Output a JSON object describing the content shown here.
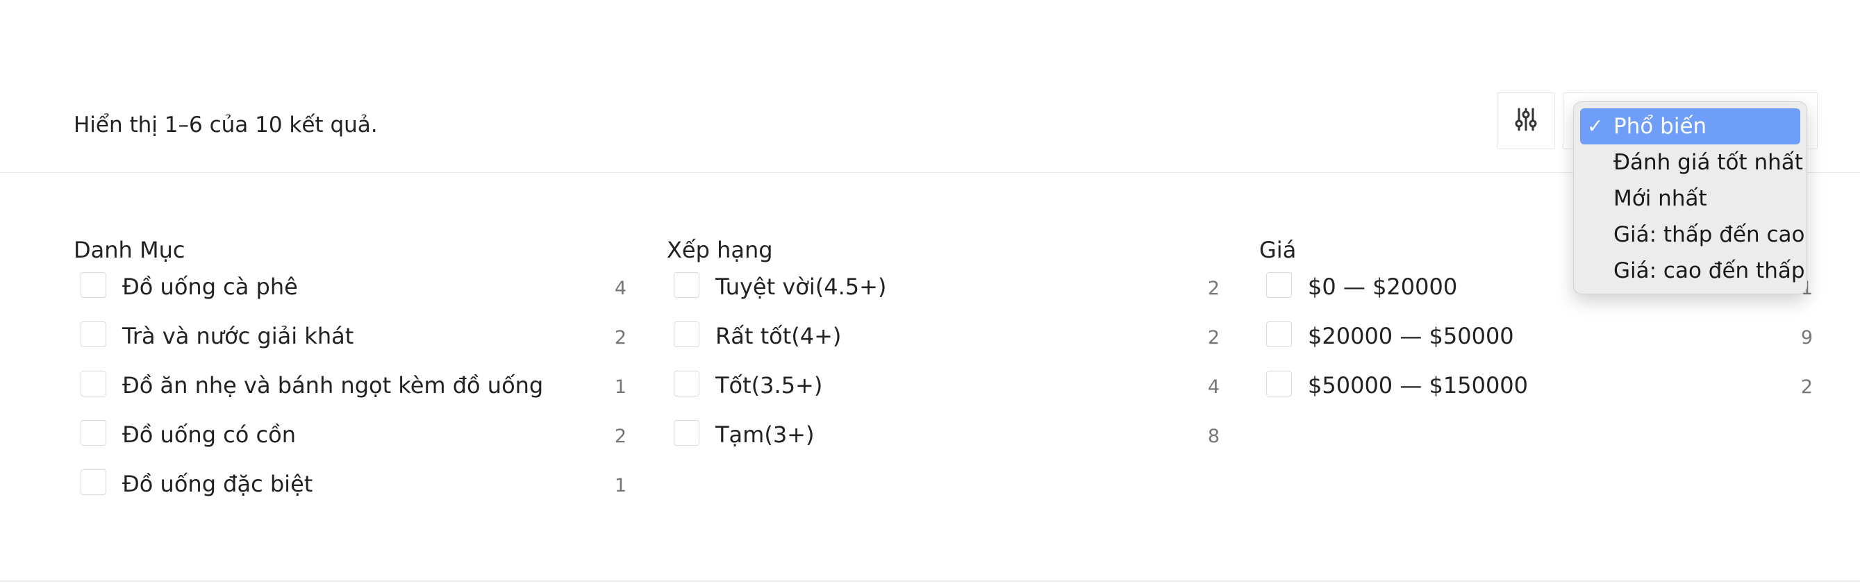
{
  "toolbar": {
    "result_text": "Hiển thị 1–6 của 10 kết quả.",
    "filter_icon": "sliders-icon",
    "sort_selected": "Phổ biến"
  },
  "sort_menu": {
    "check_mark": "✓",
    "options": [
      "Phổ biến",
      "Đánh giá tốt nhất",
      "Mới nhất",
      "Giá: thấp đến cao",
      "Giá: cao đến thấp"
    ]
  },
  "filters": {
    "category": {
      "title": "Danh Mục",
      "items": [
        {
          "label": "Đồ uống cà phê",
          "count": "4"
        },
        {
          "label": "Trà và nước giải khát",
          "count": "2"
        },
        {
          "label": "Đồ ăn nhẹ và bánh ngọt kèm đồ uống",
          "count": "1"
        },
        {
          "label": "Đồ uống có cồn",
          "count": "2"
        },
        {
          "label": "Đồ uống đặc biệt",
          "count": "1"
        }
      ]
    },
    "rating": {
      "title": "Xếp hạng",
      "items": [
        {
          "label": "Tuyệt vời(4.5+)",
          "count": "2"
        },
        {
          "label": "Rất tốt(4+)",
          "count": "2"
        },
        {
          "label": "Tốt(3.5+)",
          "count": "4"
        },
        {
          "label": "Tạm(3+)",
          "count": "8"
        }
      ]
    },
    "price": {
      "title": "Giá",
      "items": [
        {
          "label": "$0 — $20000",
          "count": "1"
        },
        {
          "label": "$20000 — $50000",
          "count": "9"
        },
        {
          "label": "$50000 — $150000",
          "count": "2"
        }
      ]
    }
  }
}
